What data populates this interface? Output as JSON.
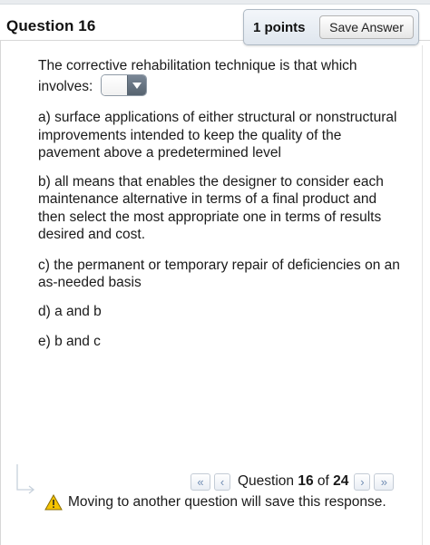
{
  "question": {
    "title": "Question 16",
    "points_label": "1 points",
    "save_label": "Save Answer",
    "prompt": "The corrective rehabilitation technique is that which involves:",
    "select_value": ""
  },
  "options": [
    "a) surface applications of either structural or nonstructural improvements intended to keep the quality of the pavement above a predetermined level",
    "b) all means that enables the designer to consider each maintenance alternative in terms of a final product and then select the most appropriate one in terms of results desired and cost.",
    "c)  the permanent or temporary repair of deficiencies on an as-needed basis",
    "d) a and b",
    "e) b and c"
  ],
  "navigation": {
    "first_icon": "double-chevron-left-icon",
    "prev_icon": "chevron-left-icon",
    "next_icon": "chevron-right-icon",
    "last_icon": "double-chevron-right-icon",
    "question_word": "Question",
    "current": "16",
    "of_word": "of",
    "total": "24"
  },
  "warning": {
    "icon": "warning-icon",
    "text": "Moving to another question will save this response."
  },
  "colors": {
    "accent": "#6f8bb2",
    "warning": "#f5c400"
  }
}
